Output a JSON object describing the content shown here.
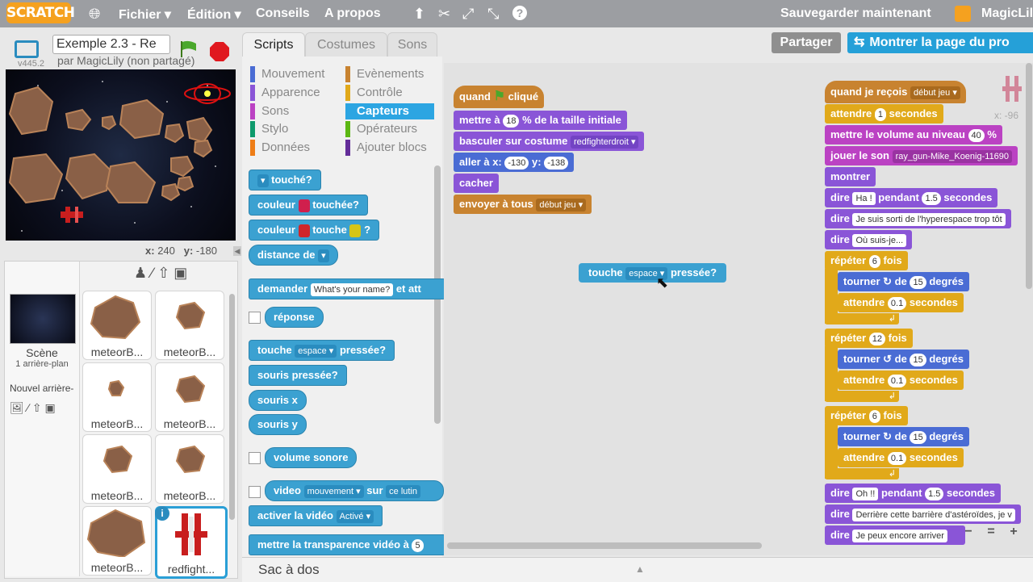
{
  "topbar": {
    "logo": "SCRATCH",
    "menu": [
      "Fichier ▾",
      "Édition ▾",
      "Conseils",
      "A propos"
    ],
    "save_now": "Sauvegarder maintenant",
    "user": "MagicLil"
  },
  "stage_header": {
    "project_title": "Exemple 2.3 - Re",
    "author": "par MagicLily (non partagé)",
    "version": "v445.2"
  },
  "share": {
    "share_label": "Partager",
    "project_page_label": "Montrer la page du pro"
  },
  "tabs": [
    "Scripts",
    "Costumes",
    "Sons"
  ],
  "stage_coords": {
    "x_label": "x:",
    "x": "240",
    "y_label": "y:",
    "y": "-180"
  },
  "scene": {
    "label": "Scène",
    "backdrops": "1 arrière-plan",
    "new_backdrop": "Nouvel arrière-"
  },
  "sprites": [
    "meteorB...",
    "meteorB...",
    "meteorB...",
    "meteorB...",
    "meteorB...",
    "meteorB...",
    "meteorB...",
    "redfight..."
  ],
  "categories": {
    "left": [
      "Mouvement",
      "Apparence",
      "Sons",
      "Stylo",
      "Données"
    ],
    "right": [
      "Evènements",
      "Contrôle",
      "Capteurs",
      "Opérateurs",
      "Ajouter blocs"
    ],
    "active": "Capteurs",
    "colors": {
      "Mouvement": "#4a6cd4",
      "Apparence": "#8a55d7",
      "Sons": "#bb42c3",
      "Stylo": "#0e9a6c",
      "Données": "#ee7d16",
      "Evènements": "#c88330",
      "Contrôle": "#e1a91a",
      "Capteurs": "#2ca5e2",
      "Opérateurs": "#5cb712",
      "Ajouter blocs": "#632d99"
    }
  },
  "palette_blocks": {
    "touched": "touché?",
    "color_touched": "couleur",
    "color_touched_end": "touchée?",
    "color_touches": "couleur",
    "color_touches_mid": "touche",
    "color_touches_end": "?",
    "distance": "distance de",
    "ask": "demander",
    "ask_default": "What's your name?",
    "ask_end": "et att",
    "answer": "réponse",
    "key": "touche",
    "key_value": "espace",
    "key_end": "pressée?",
    "mouse_down": "souris pressée?",
    "mouse_x": "souris x",
    "mouse_y": "souris y",
    "loudness": "volume sonore",
    "video": "video",
    "video_attr": "mouvement",
    "video_on": "sur",
    "video_target": "ce lutin",
    "video_toggle": "activer la vidéo",
    "video_toggle_value": "Activé",
    "video_transp": "mettre la transparence vidéo à",
    "video_transp_value": "5"
  },
  "script_left": {
    "hat": "quand",
    "hat_end": "cliqué",
    "size": "mettre à",
    "size_value": "18",
    "size_end": "% de la taille initiale",
    "costume": "basculer sur costume",
    "costume_value": "redfighterdroit",
    "goto": "aller à x:",
    "goto_x": "-130",
    "goto_y_label": "y:",
    "goto_y": "-138",
    "hide": "cacher",
    "broadcast": "envoyer à tous",
    "broadcast_value": "début jeu"
  },
  "floating_block": {
    "label": "touche",
    "value": "espace",
    "end": "pressée?"
  },
  "script_right": {
    "hat": "quand je reçois",
    "hat_value": "début jeu",
    "wait": "attendre",
    "wait_value": "1",
    "wait_end": "secondes",
    "volume": "mettre le volume au niveau",
    "volume_value": "40",
    "volume_end": "%",
    "play": "jouer le son",
    "play_value": "ray_gun-Mike_Koenig-11690",
    "show": "montrer",
    "say1": "dire",
    "say1_value": "Ha !",
    "say1_mid": "pendant",
    "say1_secs": "1.5",
    "say1_end": "secondes",
    "say2": "dire",
    "say2_value": "Je suis sorti de l'hyperespace trop tôt",
    "say3": "dire",
    "say3_value": "Où suis-je...",
    "rep1": "répéter",
    "rep1_value": "6",
    "rep1_end": "fois",
    "turn1": "tourner",
    "turn1_mid": "de",
    "turn1_value": "15",
    "turn1_end": "degrés",
    "wait1": "attendre",
    "wait1_value": "0.1",
    "wait1_end": "secondes",
    "rep2": "répéter",
    "rep2_value": "12",
    "rep2_end": "fois",
    "turn2": "tourner",
    "turn2_mid": "de",
    "turn2_value": "15",
    "turn2_end": "degrés",
    "wait2": "attendre",
    "wait2_value": "0.1",
    "wait2_end": "secondes",
    "rep3": "répéter",
    "rep3_value": "6",
    "rep3_end": "fois",
    "turn3": "tourner",
    "turn3_mid": "de",
    "turn3_value": "15",
    "turn3_end": "degrés",
    "wait3": "attendre",
    "wait3_value": "0.1",
    "wait3_end": "secondes",
    "say4": "dire",
    "say4_value": "Oh !!",
    "say4_mid": "pendant",
    "say4_secs": "1.5",
    "say4_end": "secondes",
    "say5": "dire",
    "say5_value": "Derrière cette barrière d'astéroïdes, je v",
    "say6": "dire",
    "say6_value": "Je peux encore arriver"
  },
  "sprite_coords_hint": "x: -96",
  "backpack": "Sac à dos",
  "zoom": {
    "out": "−",
    "reset": "=",
    "in": "+"
  }
}
